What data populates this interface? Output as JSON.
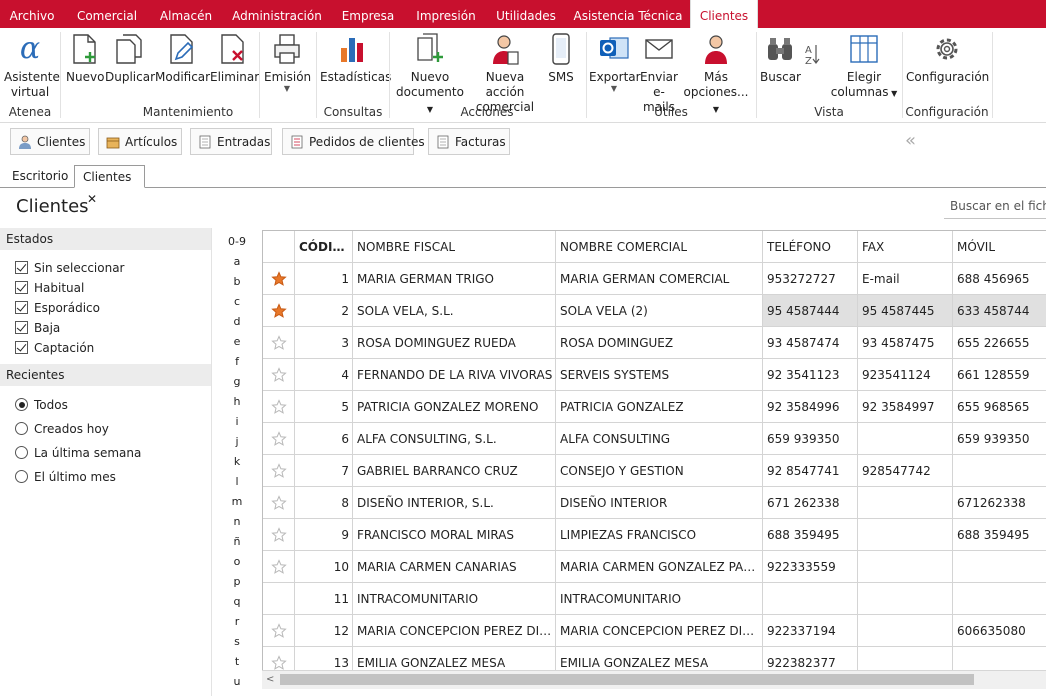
{
  "menu": {
    "tabs": [
      "Archivo",
      "Comercial",
      "Almacén",
      "Administración",
      "Empresa",
      "Impresión",
      "Utilidades",
      "Asistencia Técnica",
      "Clientes"
    ]
  },
  "ribbon": {
    "asistente": [
      "Asistente",
      "virtual"
    ],
    "nuevo": "Nuevo",
    "duplicar": "Duplicar",
    "modificar": "Modificar",
    "eliminar": "Eliminar",
    "emision": "Emisión",
    "estadisticas": "Estadísticas",
    "nuevo_documento": [
      "Nuevo",
      "documento"
    ],
    "nueva_accion": [
      "Nueva acción",
      "comercial"
    ],
    "sms": "SMS",
    "exportar": "Exportar",
    "enviar_emails": [
      "Enviar",
      "e-mails"
    ],
    "mas_opciones": [
      "Más",
      "opciones..."
    ],
    "buscar": "Buscar",
    "elegir_columnas": [
      "Elegir",
      "columnas"
    ],
    "configuracion": "Configuración",
    "groups": {
      "atenea": "Atenea",
      "mantenimiento": "Mantenimiento",
      "consultas": "Consultas",
      "acciones": "Acciones",
      "utiles": "Útiles",
      "vista": "Vista",
      "configuracion": "Configuración"
    }
  },
  "shortcuts": [
    "Clientes",
    "Artículos",
    "Entradas",
    "Pedidos de clientes",
    "Facturas"
  ],
  "doc_tabs": {
    "escritorio": "Escritorio",
    "clientes": "Clientes"
  },
  "page_title": "Clientes",
  "search": {
    "placeholder": "Buscar en el fichero"
  },
  "filters": {
    "estados_title": "Estados",
    "estados": [
      "Sin seleccionar",
      "Habitual",
      "Esporádico",
      "Baja",
      "Captación"
    ],
    "recientes_title": "Recientes",
    "recientes": [
      "Todos",
      "Creados hoy",
      "La última semana",
      "El último mes"
    ],
    "recientes_selected": "Todos"
  },
  "alphabet": [
    "0-9",
    "a",
    "b",
    "c",
    "d",
    "e",
    "f",
    "g",
    "h",
    "i",
    "j",
    "k",
    "l",
    "m",
    "n",
    "ñ",
    "o",
    "p",
    "q",
    "r",
    "s",
    "t",
    "u"
  ],
  "table": {
    "headers": [
      "CÓDIGO",
      "NOMBRE FISCAL",
      "NOMBRE COMERCIAL",
      "TELÉFONO",
      "FAX",
      "MÓVIL"
    ],
    "rows": [
      {
        "fav": true,
        "codigo": "1",
        "fiscal": "MARIA GERMAN TRIGO",
        "comercial": "MARIA GERMAN COMERCIAL",
        "telefono": "953272727",
        "fax": "E-mail",
        "movil": "688 456965"
      },
      {
        "fav": true,
        "codigo": "2",
        "fiscal": "SOLA VELA, S.L.",
        "comercial": "SOLA VELA  (2)",
        "telefono": "95 4587444",
        "fax": "95 4587445",
        "movil": "633 458744",
        "highlight": true
      },
      {
        "fav": false,
        "codigo": "3",
        "fiscal": "ROSA DOMINGUEZ RUEDA",
        "comercial": "ROSA DOMINGUEZ",
        "telefono": "93 4587474",
        "fax": "93 4587475",
        "movil": "655 226655"
      },
      {
        "fav": false,
        "codigo": "4",
        "fiscal": "FERNANDO DE LA RIVA VIVORAS",
        "comercial": "SERVEIS SYSTEMS",
        "telefono": "92 3541123",
        "fax": "923541124",
        "movil": "661 128559"
      },
      {
        "fav": false,
        "codigo": "5",
        "fiscal": "PATRICIA GONZALEZ MORENO",
        "comercial": "PATRICIA GONZALEZ",
        "telefono": "92 3584996",
        "fax": "92 3584997",
        "movil": "655 968565"
      },
      {
        "fav": false,
        "codigo": "6",
        "fiscal": "ALFA CONSULTING, S.L.",
        "comercial": "ALFA CONSULTING",
        "telefono": "659 939350",
        "fax": "",
        "movil": "659 939350"
      },
      {
        "fav": false,
        "codigo": "7",
        "fiscal": "GABRIEL BARRANCO CRUZ",
        "comercial": "CONSEJO Y GESTION",
        "telefono": "92 8547741",
        "fax": "928547742",
        "movil": ""
      },
      {
        "fav": false,
        "codigo": "8",
        "fiscal": "DISEÑO INTERIOR, S.L.",
        "comercial": "DISEÑO INTERIOR",
        "telefono": "671 262338",
        "fax": "",
        "movil": "671262338"
      },
      {
        "fav": false,
        "codigo": "9",
        "fiscal": "FRANCISCO MORAL MIRAS",
        "comercial": "LIMPIEZAS FRANCISCO",
        "telefono": "688 359495",
        "fax": "",
        "movil": "688 359495"
      },
      {
        "fav": false,
        "codigo": "10",
        "fiscal": "MARIA CARMEN CANARIAS",
        "comercial": "MARIA CARMEN GONZALEZ PADILLA",
        "telefono": "922333559",
        "fax": "",
        "movil": ""
      },
      {
        "fav": false,
        "codigo": "11",
        "fiscal": "INTRACOMUNITARIO",
        "comercial": "INTRACOMUNITARIO",
        "telefono": "",
        "fax": "",
        "movil": "",
        "nostar": true
      },
      {
        "fav": false,
        "codigo": "12",
        "fiscal": "MARIA CONCEPCION PEREZ DIAZ",
        "comercial": "MARIA CONCEPCION PEREZ DIAZ",
        "telefono": "922337194",
        "fax": "",
        "movil": "606635080"
      },
      {
        "fav": false,
        "codigo": "13",
        "fiscal": "EMILIA GONZALEZ MESA",
        "comercial": "EMILIA GONZALEZ MESA",
        "telefono": "922382377",
        "fax": "",
        "movil": ""
      }
    ]
  },
  "colors": {
    "brand": "#c8102e",
    "star": "#e8782a"
  }
}
